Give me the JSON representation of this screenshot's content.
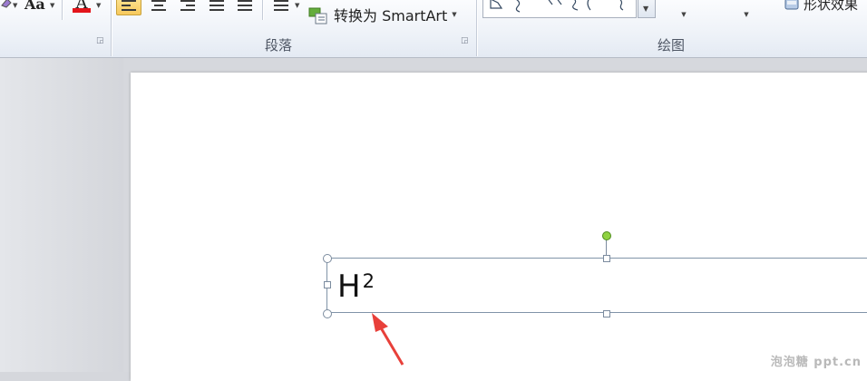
{
  "ribbon": {
    "font_case_label": "Aa",
    "font_color_label": "A",
    "font_color_accent": "#e3141b",
    "active_align_color": "#f7c95c",
    "convert_smartart_label": "转换为 SmartArt",
    "shape_effects_label": "形状效果",
    "groups": {
      "paragraph": "段落",
      "drawing": "绘图"
    }
  },
  "slide": {
    "textbox": {
      "text": "H",
      "superscript": "2"
    }
  },
  "annotation": {
    "arrow_color": "#e8403a"
  },
  "watermark": "泡泡糖 ppt.cn"
}
